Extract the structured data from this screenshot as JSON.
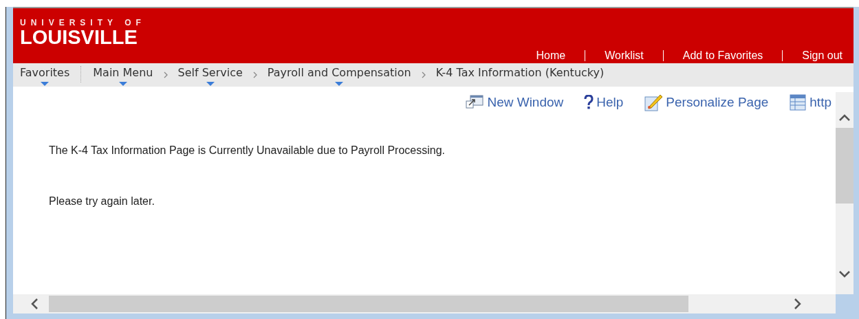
{
  "header": {
    "logo_top": "UNIVERSITY OF",
    "logo_main": "LOUISVILLE",
    "links": [
      "Home",
      "Worklist",
      "Add to Favorites",
      "Sign out"
    ]
  },
  "breadcrumbs": [
    {
      "label": "Favorites",
      "dropdown": true
    },
    {
      "label": "Main Menu",
      "dropdown": true
    },
    {
      "label": "Self Service",
      "dropdown": true
    },
    {
      "label": "Payroll and Compensation",
      "dropdown": true
    },
    {
      "label": "K-4 Tax Information (Kentucky)",
      "dropdown": false
    }
  ],
  "toolbar": [
    {
      "kind": "new-window",
      "label": "New Window"
    },
    {
      "kind": "help",
      "label": "Help"
    },
    {
      "kind": "personalize",
      "label": "Personalize Page"
    },
    {
      "kind": "http",
      "label": "http"
    }
  ],
  "messages": [
    "The K-4 Tax Information Page is Currently Unavailable due to Payroll Processing.",
    "Please try again later."
  ]
}
